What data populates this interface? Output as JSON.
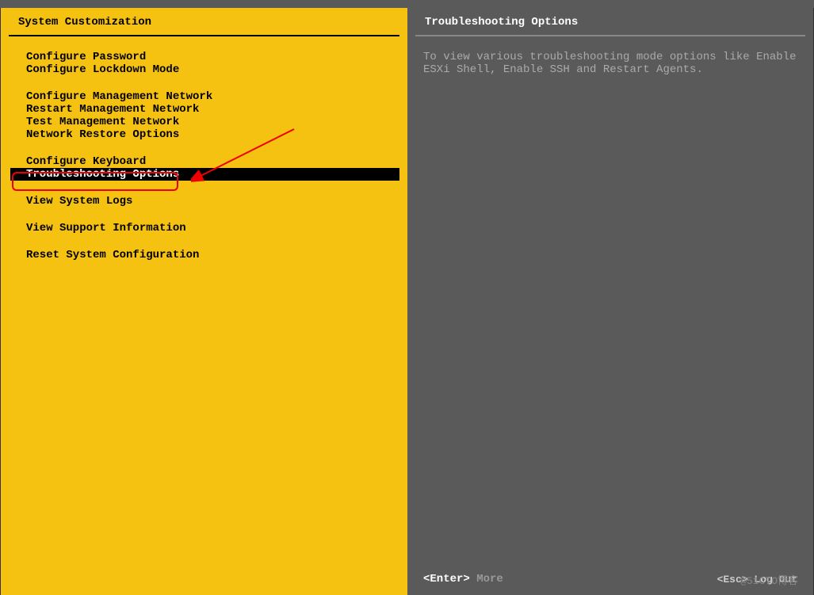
{
  "leftPanel": {
    "title": "System Customization",
    "groups": [
      {
        "items": [
          {
            "label": "Configure Password",
            "selected": false
          },
          {
            "label": "Configure Lockdown Mode",
            "selected": false
          }
        ]
      },
      {
        "items": [
          {
            "label": "Configure Management Network",
            "selected": false
          },
          {
            "label": "Restart Management Network",
            "selected": false
          },
          {
            "label": "Test Management Network",
            "selected": false
          },
          {
            "label": "Network Restore Options",
            "selected": false
          }
        ]
      },
      {
        "items": [
          {
            "label": "Configure Keyboard",
            "selected": false
          },
          {
            "label": "Troubleshooting Options",
            "selected": true
          }
        ]
      },
      {
        "items": [
          {
            "label": "View System Logs",
            "selected": false
          }
        ]
      },
      {
        "items": [
          {
            "label": "View Support Information",
            "selected": false
          }
        ]
      },
      {
        "items": [
          {
            "label": "Reset System Configuration",
            "selected": false
          }
        ]
      }
    ]
  },
  "rightPanel": {
    "title": "Troubleshooting Options",
    "description": "To view various troubleshooting mode options like Enable ESXi Shell, Enable SSH and Restart Agents."
  },
  "bottomBar": {
    "enterKey": "<Enter>",
    "enterLabel": "More",
    "escKey": "<Esc>",
    "escLabel": "Log Out"
  },
  "watermark": "@51CTO博客"
}
